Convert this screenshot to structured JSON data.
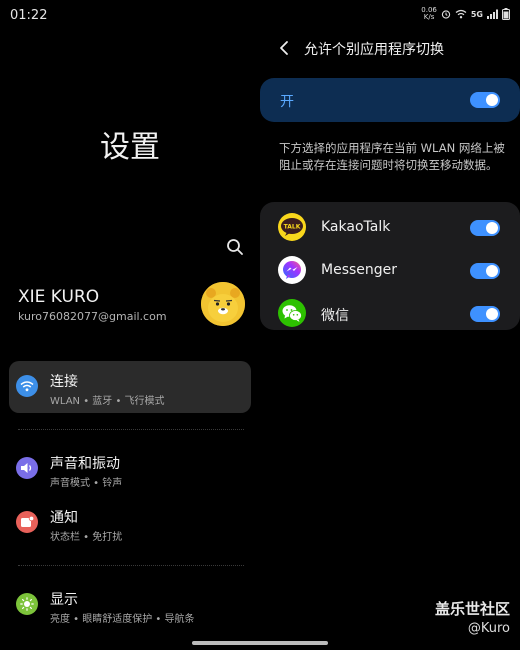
{
  "status_bar": {
    "time": "01:22",
    "net_speed": "0.06",
    "net_unit": "K/s",
    "icons": [
      "alarm-icon",
      "wifi-icon",
      "5g-icon",
      "signal-icon",
      "battery-icon"
    ],
    "network": "5G"
  },
  "settings": {
    "title": "设置",
    "profile": {
      "name": "XIE KURO",
      "email": "kuro76082077@gmail.com"
    },
    "items": [
      {
        "title": "连接",
        "subtitle": "WLAN  •  蓝牙  •  飞行模式",
        "icon": "wifi-icon",
        "color": "#3d8fe8"
      },
      {
        "title": "声音和振动",
        "subtitle": "声音模式  •  铃声",
        "icon": "volume-icon",
        "color": "#7a6ee8"
      },
      {
        "title": "通知",
        "subtitle": "状态栏  •  免打扰",
        "icon": "notification-icon",
        "color": "#e8615a"
      },
      {
        "title": "显示",
        "subtitle": "亮度  •  眼睛舒适度保护  •  导航条",
        "icon": "sun-icon",
        "color": "#7cc33a"
      }
    ]
  },
  "detail": {
    "title": "允许个别应用程序切换",
    "master": {
      "label": "开",
      "on": true
    },
    "description": "下方选择的应用程序在当前 WLAN 网络上被阻止或存在连接问题时将切换至移动数据。",
    "apps": [
      {
        "name": "KakaoTalk",
        "icon": "kakaotalk-icon",
        "icon_text": "TALK",
        "on": true
      },
      {
        "name": "Messenger",
        "icon": "messenger-icon",
        "on": true
      },
      {
        "name": "微信",
        "icon": "wechat-icon",
        "on": true
      }
    ]
  },
  "watermark": {
    "text": "盖乐世社区",
    "sub": "@Kuro"
  },
  "colors": {
    "accent": "#3e91ff",
    "master_card": "#0d2d52",
    "master_label": "#5aa9ff",
    "card_bg": "#1c1c1e"
  }
}
